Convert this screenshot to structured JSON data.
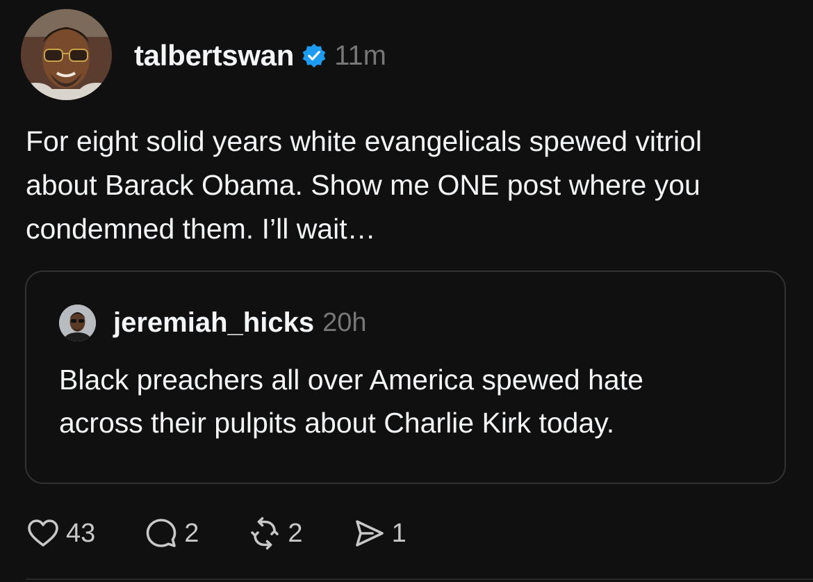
{
  "post": {
    "username": "talbertswan",
    "timestamp": "11m",
    "verified_color": "#1d9bf0",
    "text": "For eight solid years white evangelicals spewed vitriol\nabout Barack Obama. Show me ONE post where you\ncondemned them. I’ll wait…",
    "quoted": {
      "username": "jeremiah_hicks",
      "timestamp": "20h",
      "text": "Black preachers all over America  spewed hate\nacross their pulpits about Charlie Kirk today."
    },
    "actions": {
      "likes": "43",
      "replies": "2",
      "reposts": "2",
      "shares": "1"
    }
  },
  "icons": {
    "like": "heart-icon",
    "reply": "comment-icon",
    "repost": "repost-icon",
    "share": "send-icon",
    "verified": "verified-badge-icon"
  }
}
